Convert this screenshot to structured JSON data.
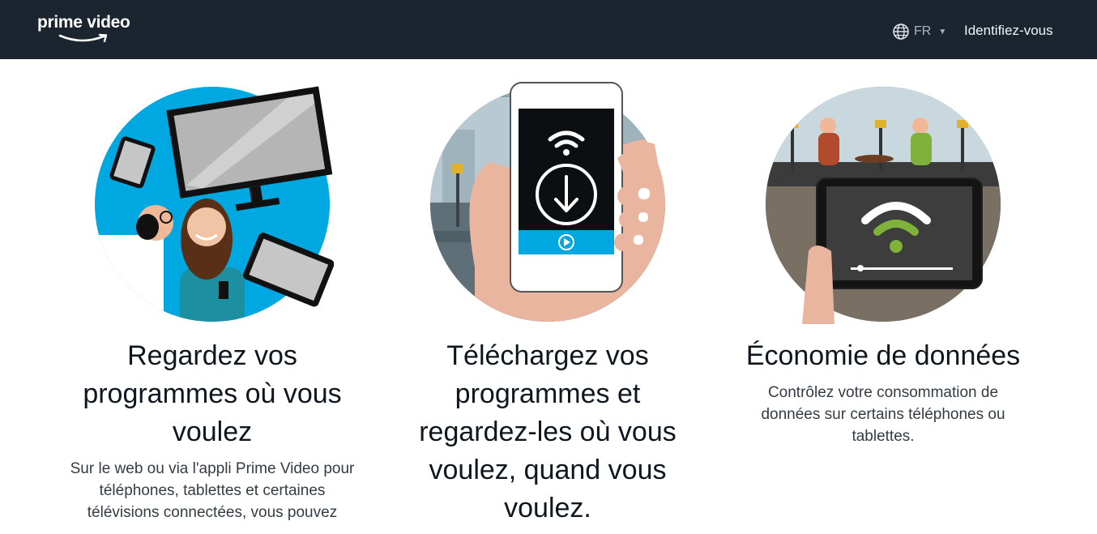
{
  "header": {
    "logo_text": "prime video",
    "language": "FR",
    "signin_label": "Identifiez-vous"
  },
  "features": [
    {
      "title": "Regardez vos programmes où vous voulez",
      "text": "Sur le web ou via l'appli Prime Video pour téléphones, tablettes et certaines télévisions connectées, vous pouvez"
    },
    {
      "title": "Téléchargez vos programmes et regardez-les où vous voulez, quand vous voulez.",
      "text": ""
    },
    {
      "title": "Économie de données",
      "text": "Contrôlez votre consommation de données sur certains téléphones ou tablettes."
    }
  ],
  "icons": {
    "globe": "globe-icon",
    "chevron": "chevron-down-icon",
    "download": "download-icon",
    "wifi": "wifi-icon",
    "play": "play-icon"
  },
  "colors": {
    "header_bg": "#1b2530",
    "accent_blue": "#00a8e1",
    "wifi_green": "#7fb23a"
  }
}
